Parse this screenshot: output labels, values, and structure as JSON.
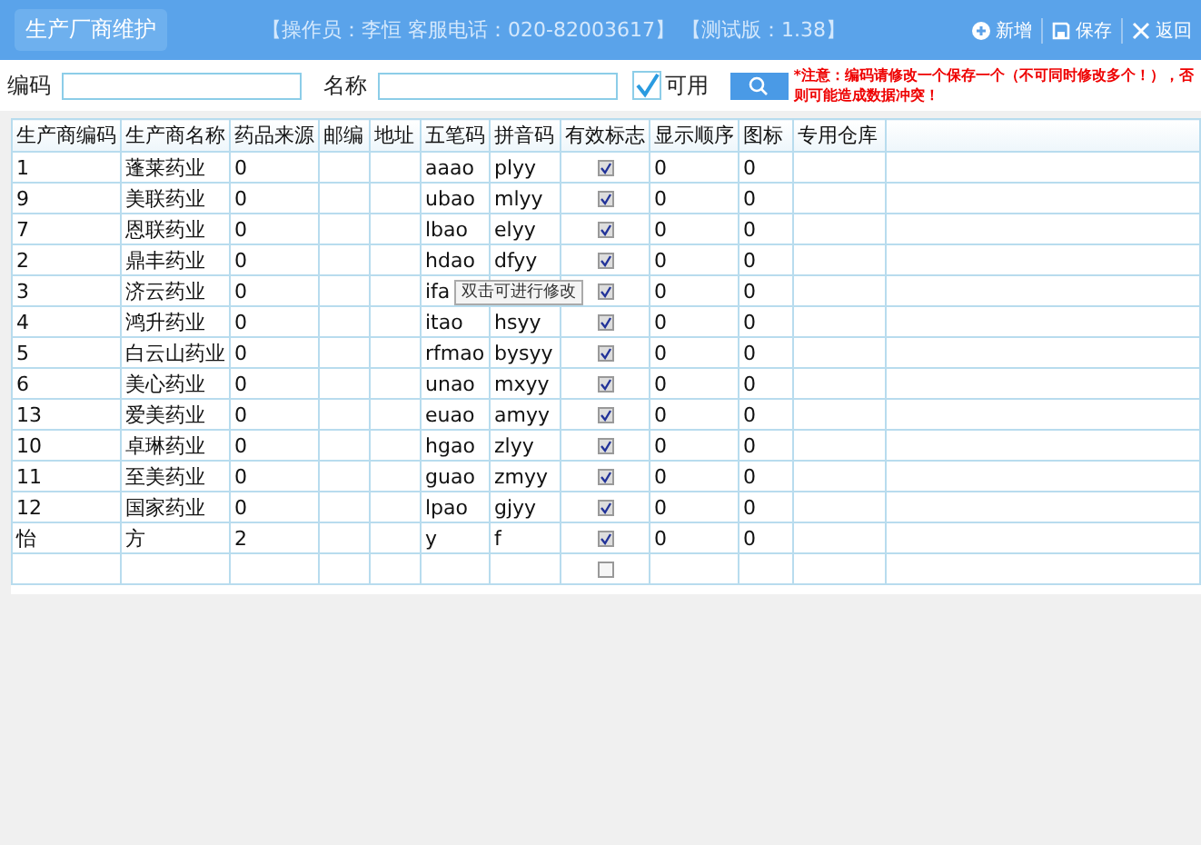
{
  "window": {
    "title": "生产厂商维护",
    "info": "【操作员：李恒  客服电话：020-82003617】  【测试版：1.38】"
  },
  "toolbar": [
    {
      "kind": "add",
      "label": "新增"
    },
    {
      "kind": "save",
      "label": "保存"
    },
    {
      "kind": "back",
      "label": "返回"
    }
  ],
  "filters": {
    "code_label": "编码",
    "name_label": "名称",
    "enabled_label": "可用",
    "enabled_checked": true,
    "notice": "*注意：编码请修改一个保存一个（不可同时修改多个！），否则可能造成数据冲突！"
  },
  "table": {
    "columns": [
      "生产商编码",
      "生产商名称",
      "药品来源",
      "邮编",
      "地址",
      "五笔码",
      "拼音码",
      "有效标志",
      "显示顺序",
      "图标",
      "专用仓库"
    ],
    "rows": [
      {
        "code": "1",
        "name": "蓬莱药业",
        "source": "0",
        "wubi": "aaao",
        "pinyin": "plyy",
        "valid": true,
        "order": "0",
        "icon": "0"
      },
      {
        "code": "9",
        "name": "美联药业",
        "source": "0",
        "wubi": "ubao",
        "pinyin": "mlyy",
        "valid": true,
        "order": "0",
        "icon": "0"
      },
      {
        "code": "7",
        "name": "恩联药业",
        "source": "0",
        "wubi": "lbao",
        "pinyin": "elyy",
        "valid": true,
        "order": "0",
        "icon": "0"
      },
      {
        "code": "2",
        "name": "鼎丰药业",
        "source": "0",
        "wubi": "hdao",
        "pinyin": "dfyy",
        "valid": true,
        "order": "0",
        "icon": "0"
      },
      {
        "code": "3",
        "name": "济云药业",
        "source": "0",
        "wubi": "ifa",
        "valid": true,
        "order": "0",
        "icon": "0"
      },
      {
        "code": "4",
        "name": "鸿升药业",
        "source": "0",
        "wubi": "itao",
        "pinyin": "hsyy",
        "valid": true,
        "order": "0",
        "icon": "0"
      },
      {
        "code": "5",
        "name": "白云山药业",
        "source": "0",
        "wubi": "rfmao",
        "pinyin": "bysyy",
        "valid": true,
        "order": "0",
        "icon": "0"
      },
      {
        "code": "6",
        "name": "美心药业",
        "source": "0",
        "wubi": "unao",
        "pinyin": "mxyy",
        "valid": true,
        "order": "0",
        "icon": "0"
      },
      {
        "code": "13",
        "name": "爱美药业",
        "source": "0",
        "wubi": "euao",
        "pinyin": "amyy",
        "valid": true,
        "order": "0",
        "icon": "0"
      },
      {
        "code": "10",
        "name": "卓琳药业",
        "source": "0",
        "wubi": "hgao",
        "pinyin": "zlyy",
        "valid": true,
        "order": "0",
        "icon": "0"
      },
      {
        "code": "11",
        "name": "至美药业",
        "source": "0",
        "wubi": "guao",
        "pinyin": "zmyy",
        "valid": true,
        "order": "0",
        "icon": "0"
      },
      {
        "code": "12",
        "name": "国家药业",
        "source": "0",
        "wubi": "lpao",
        "pinyin": "gjyy",
        "valid": true,
        "order": "0",
        "icon": "0"
      },
      {
        "code": "怡",
        "name": "方",
        "source": "2",
        "wubi": "y",
        "pinyin": "f",
        "valid": true,
        "order": "0",
        "icon": "0"
      },
      {
        "valid": false
      }
    ]
  },
  "tooltip": "双击可进行修改"
}
